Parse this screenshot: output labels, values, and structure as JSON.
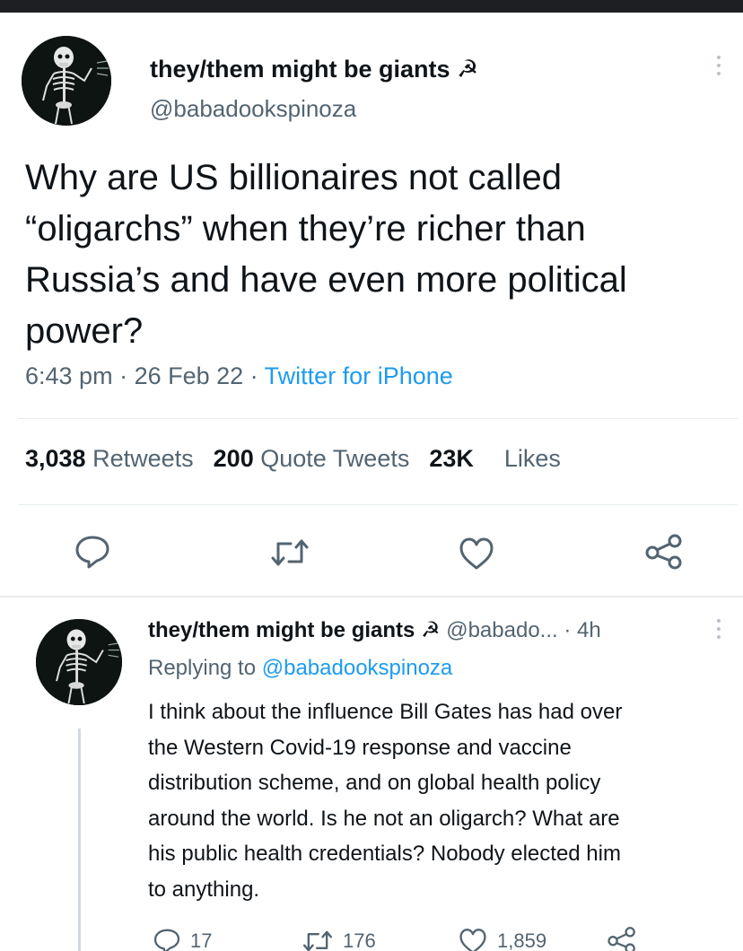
{
  "colors": {
    "link": "#1d9bf0",
    "secondary": "#536471",
    "text": "#0f1419"
  },
  "tweet": {
    "display_name": "they/them might be giants ☭",
    "handle": "@babadookspinoza",
    "text_lines": [
      "Why are US billionaires not called",
      "“oligarchs” when they’re richer than",
      "Russia’s and have even more political",
      "power?"
    ],
    "time": "6:43 pm",
    "date": "26 Feb 22",
    "source": "Twitter for iPhone",
    "stats": {
      "retweets_count": "3,038",
      "retweets_label": "Retweets",
      "quotes_count": "200",
      "quotes_label": "Quote Tweets",
      "likes_count": "23K",
      "likes_label": "Likes"
    },
    "actions": [
      "reply-icon",
      "retweet-icon",
      "like-icon",
      "share-icon"
    ]
  },
  "reply": {
    "display_name": "they/them might be giants ☭",
    "handle": "@babado...",
    "time": "· 4h",
    "replying_prefix": "Replying to",
    "replying_handle": "@babadookspinoza",
    "text_lines": [
      "I think about the influence Bill Gates has had over",
      "the Western Covid-19 response and vaccine",
      "distribution scheme, and on global health policy",
      "around the world. Is he not an oligarch? What are",
      "his public health credentials? Nobody elected him",
      "to anything."
    ],
    "reply_count": "17",
    "retweet_count": "176",
    "like_count": "1,859"
  }
}
